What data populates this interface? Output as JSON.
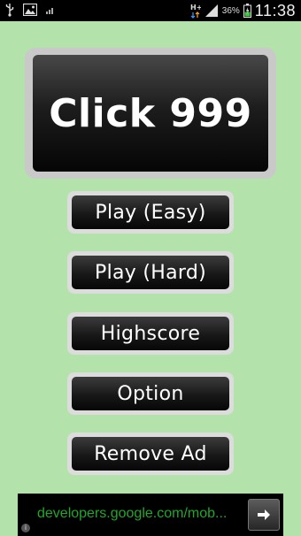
{
  "status_bar": {
    "icons": [
      "usb-icon",
      "image-icon",
      "signal-small-icon",
      "network-type-icon",
      "signal-icon",
      "battery-icon"
    ],
    "network_type": "H+",
    "battery_percent": "36%",
    "time": "11:38"
  },
  "game": {
    "title": "Click 999",
    "menu": [
      {
        "label": "Play (Easy)"
      },
      {
        "label": "Play (Hard)"
      },
      {
        "label": "Highscore"
      },
      {
        "label": "Option"
      },
      {
        "label": "Remove Ad"
      }
    ]
  },
  "ad": {
    "text": "developers.google.com/mob...",
    "info_symbol": "i",
    "arrow_icon": "arrow-right-icon"
  },
  "colors": {
    "background": "#b3e3ab",
    "button_face": "#0d0d0d",
    "button_border": "#dcdcdc",
    "ad_text": "#1fa82a"
  }
}
